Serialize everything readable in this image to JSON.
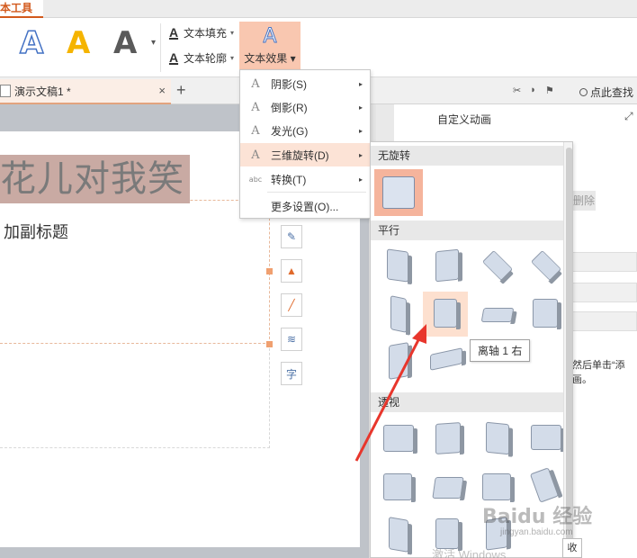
{
  "ribbon": {
    "tab_label": "本工具",
    "style_glyph": "A",
    "more": "▾",
    "text_fill": "文本填充",
    "text_outline": "文本轮廓",
    "text_effect": "文本效果",
    "caret": "▾"
  },
  "docbar": {
    "doc_title": "演示文稿1 *",
    "close": "×",
    "new_tab": "+",
    "search": "点此查找"
  },
  "slide": {
    "title": "花儿对我笑",
    "subtitle": "加副标题"
  },
  "right_pane": {
    "title": "自定义动画",
    "collapse": "⤢",
    "peek_button": "删除",
    "hint_line1": "然后单击“添",
    "hint_line2": "画。"
  },
  "menu": {
    "items": [
      {
        "icon": "A",
        "label": "阴影(S)",
        "arrow": "▸"
      },
      {
        "icon": "A",
        "label": "倒影(R)",
        "arrow": "▸"
      },
      {
        "icon": "A",
        "label": "发光(G)",
        "arrow": "▸"
      },
      {
        "icon": "A",
        "label": "三维旋转(D)",
        "arrow": "▸"
      },
      {
        "icon": "abc",
        "label": "转换(T)",
        "arrow": "▸"
      },
      {
        "icon": "",
        "label": "更多设置(O)...",
        "arrow": ""
      }
    ]
  },
  "submenu": {
    "section_none": "无旋转",
    "section_parallel": "平行",
    "section_perspective": "透视",
    "tooltip": "离轴 1 右"
  },
  "watermark": {
    "brand": "Baidu 经验",
    "url": "jingyan.baidu.com",
    "faded": "激活 Windows",
    "page_button": "收"
  },
  "colors": {
    "accent": "#d2591c",
    "highlight": "#f9c7b0",
    "arrow": "#e8362c"
  }
}
